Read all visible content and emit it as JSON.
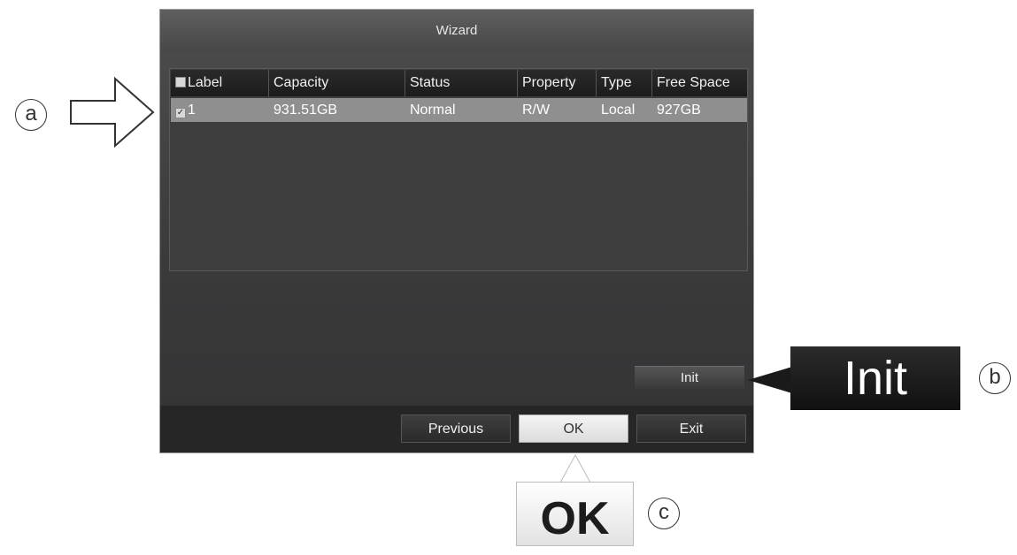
{
  "wizard": {
    "title": "Wizard",
    "table": {
      "headers": {
        "label": "Label",
        "capacity": "Capacity",
        "status": "Status",
        "property": "Property",
        "type": "Type",
        "free_space": "Free Space"
      },
      "rows": [
        {
          "label": "1",
          "capacity": "931.51GB",
          "status": "Normal",
          "property": "R/W",
          "type": "Local",
          "free_space": "927GB",
          "checked": true
        }
      ]
    },
    "init_label": "Init",
    "footer": {
      "previous_label": "Previous",
      "ok_label": "OK",
      "exit_label": "Exit"
    }
  },
  "annotations": {
    "a_marker": "a",
    "b_marker": "b",
    "c_marker": "c",
    "init_callout": "Init",
    "ok_callout": "OK"
  },
  "colors": {
    "window_bg": "#2c2c2d",
    "selected_row": "#8f8f8f",
    "ok_button": "#e8e8e8"
  }
}
